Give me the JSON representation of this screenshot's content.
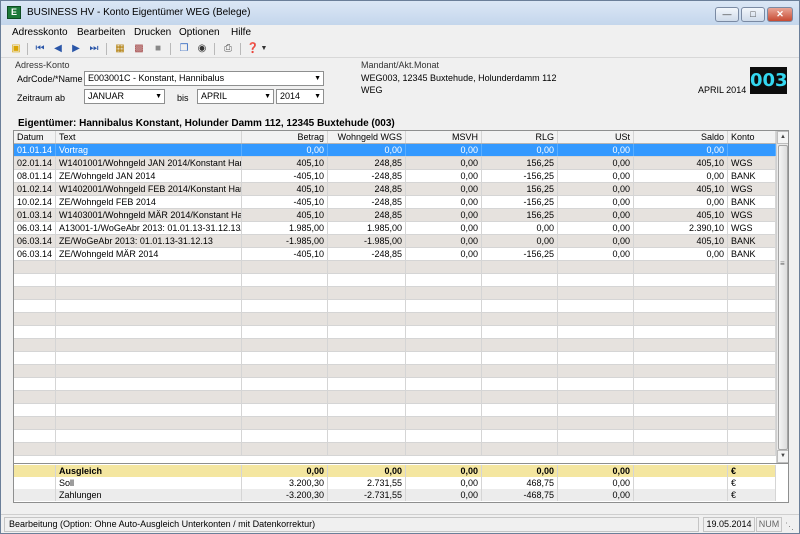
{
  "window": {
    "title": "BUSINESS HV - Konto Eigentümer WEG (Belege)",
    "app_icon_glyph": "E"
  },
  "menu": [
    "Adresskonto",
    "Bearbeiten",
    "Drucken",
    "Optionen",
    "Hilfe"
  ],
  "toolbar": {
    "icons": [
      "open-folder-icon",
      "first-record-icon",
      "previous-record-icon",
      "next-record-icon",
      "last-record-icon",
      "calendar-icon",
      "edit-table-icon",
      "note-icon",
      "copy-icon",
      "binoculars-icon",
      "print-icon",
      "help-icon"
    ]
  },
  "form": {
    "group_label": "Adress-Konto",
    "adrcode_label": "AdrCode/*Name",
    "adrcode_value": "E003001C - Konstant, Hannibalus",
    "zeitraum_label": "Zeitraum ab",
    "from_month": "JANUAR",
    "bis_label": "bis",
    "to_month": "APRIL",
    "year": "2014"
  },
  "mandant": {
    "label": "Mandant/Akt.Monat",
    "line1": "WEG003, 12345 Buxtehude, Holunderdamm 112",
    "line2": "WEG",
    "month": "APRIL 2014",
    "number": "003"
  },
  "owner_line": "Eigentümer: Hannibalus Konstant, Holunder Damm 112, 12345 Buxtehude (003)",
  "table": {
    "headers": [
      "Datum",
      "Text",
      "Betrag",
      "Wohngeld WGS",
      "MSVH",
      "RLG",
      "USt",
      "Saldo",
      "Konto"
    ],
    "rows": [
      [
        "01.01.14",
        "Vortrag",
        "0,00",
        "0,00",
        "0,00",
        "0,00",
        "0,00",
        "0,00",
        ""
      ],
      [
        "02.01.14",
        "W1401001/Wohngeld JAN 2014/Konstant Har",
        "405,10",
        "248,85",
        "0,00",
        "156,25",
        "0,00",
        "405,10",
        "WGS"
      ],
      [
        "08.01.14",
        "ZE/Wohngeld JAN 2014",
        "-405,10",
        "-248,85",
        "0,00",
        "-156,25",
        "0,00",
        "0,00",
        "BANK"
      ],
      [
        "01.02.14",
        "W1402001/Wohngeld FEB 2014/Konstant Har",
        "405,10",
        "248,85",
        "0,00",
        "156,25",
        "0,00",
        "405,10",
        "WGS"
      ],
      [
        "10.02.14",
        "ZE/Wohngeld FEB 2014",
        "-405,10",
        "-248,85",
        "0,00",
        "-156,25",
        "0,00",
        "0,00",
        "BANK"
      ],
      [
        "01.03.14",
        "W1403001/Wohngeld MÄR 2014/Konstant Ha",
        "405,10",
        "248,85",
        "0,00",
        "156,25",
        "0,00",
        "405,10",
        "WGS"
      ],
      [
        "06.03.14",
        "A13001-1/WoGeAbr 2013: 01.01.13-31.12.13/l",
        "1.985,00",
        "1.985,00",
        "0,00",
        "0,00",
        "0,00",
        "2.390,10",
        "WGS"
      ],
      [
        "06.03.14",
        "ZE/WoGeAbr 2013: 01.01.13-31.12.13",
        "-1.985,00",
        "-1.985,00",
        "0,00",
        "0,00",
        "0,00",
        "405,10",
        "BANK"
      ],
      [
        "06.03.14",
        "ZE/Wohngeld MÄR 2014",
        "-405,10",
        "-248,85",
        "0,00",
        "-156,25",
        "0,00",
        "0,00",
        "BANK"
      ]
    ],
    "selected_row": 0
  },
  "summary": [
    [
      "Ausgleich",
      "0,00",
      "0,00",
      "0,00",
      "0,00",
      "0,00",
      "",
      "€"
    ],
    [
      "Soll",
      "3.200,30",
      "2.731,55",
      "0,00",
      "468,75",
      "0,00",
      "",
      "€"
    ],
    [
      "Zahlungen",
      "-3.200,30",
      "-2.731,55",
      "0,00",
      "-468,75",
      "0,00",
      "",
      "€"
    ]
  ],
  "status": {
    "main": "Bearbeitung (Option: Ohne Auto-Ausgleich Unterkonten / mit Datenkorrektur)",
    "date": "19.05.2014",
    "num": "NUM"
  },
  "colors": {
    "selection": "#3399ff",
    "ausgleich_bg": "#f4e6a0",
    "badge_text": "#34d7f0"
  }
}
